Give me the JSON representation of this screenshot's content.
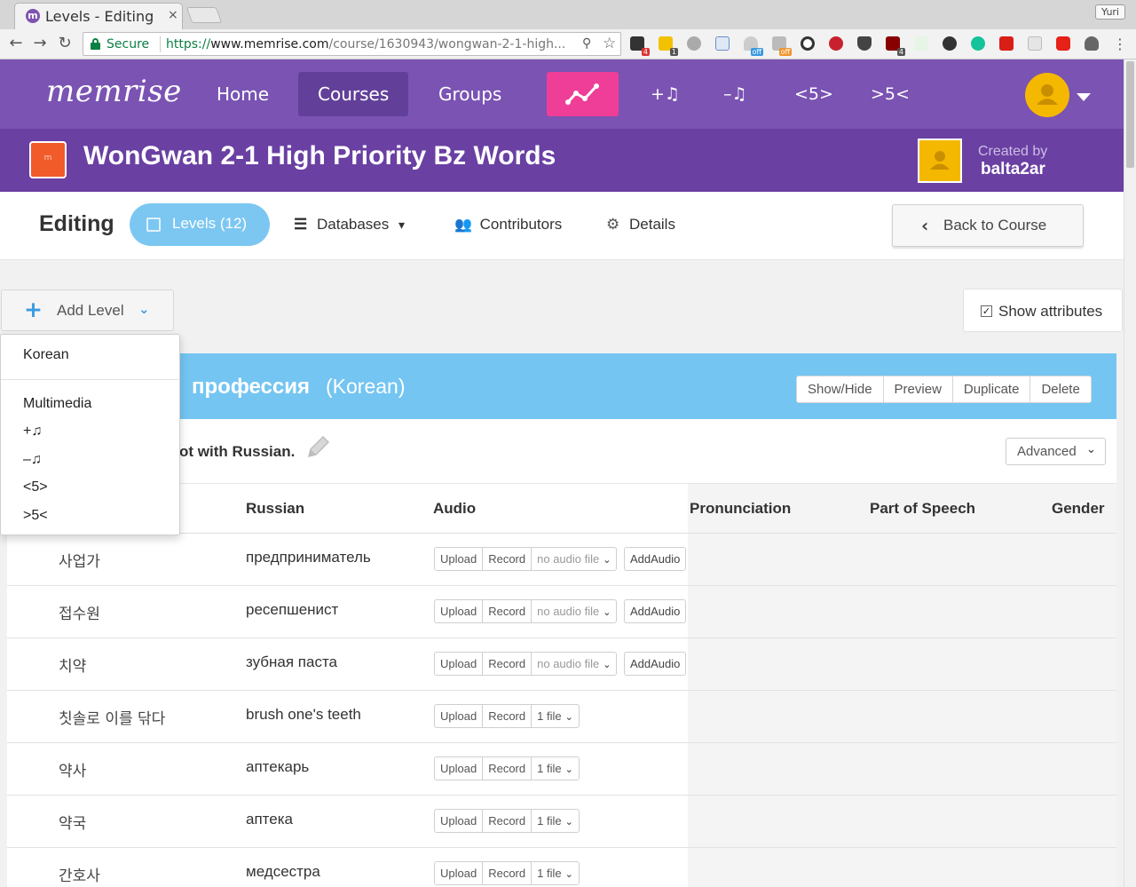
{
  "browser": {
    "tab_title": "Levels - Editing",
    "tab_close": "×",
    "profile_name": "Yuri",
    "secure_label": "Secure",
    "url_scheme": "https://",
    "url_host": "www.memrise.com",
    "url_path": "/course/1630943/wongwan-2-1-high...",
    "extension_badges": [
      "4",
      "1",
      "off",
      "off",
      "4"
    ]
  },
  "topnav": {
    "logo": "memrise",
    "items": [
      {
        "label": "Home",
        "active": false
      },
      {
        "label": "Courses",
        "active": true
      },
      {
        "label": "Groups",
        "active": false
      }
    ],
    "symbols": [
      "+♫",
      "–♫",
      "<5>",
      ">5<"
    ]
  },
  "course": {
    "icon_letter": "m",
    "title": "WonGwan 2-1 High Priority Bz Words",
    "created_by_label": "Created by",
    "creator": "balta2ar"
  },
  "editing": {
    "heading": "Editing",
    "tabs": {
      "levels": "Levels (12)",
      "databases": "Databases",
      "contributors": "Contributors",
      "details": "Details"
    },
    "back_label": "Back to Course"
  },
  "add_level": {
    "label": "Add Level",
    "menu": [
      "Korean",
      "Multimedia",
      "+♫",
      "–♫",
      "<5>",
      ">5<"
    ]
  },
  "show_attributes": {
    "label": "Show attributes",
    "checked": true
  },
  "level": {
    "name_visible": "профессия",
    "language": "(Korean)",
    "actions": [
      "Show/Hide",
      "Preview",
      "Duplicate",
      "Delete"
    ],
    "tester_text": "ot with Russian.",
    "advanced_label": "Advanced",
    "columns": [
      "Russian",
      "Audio",
      "Pronunciation",
      "Part of Speech",
      "Gender"
    ],
    "audio_buttons": {
      "upload": "Upload",
      "record": "Record",
      "add_audio": "AddAudio"
    },
    "rows": [
      {
        "korean": "사업가",
        "russian": "предприниматель",
        "audio": "no audio file",
        "has_audio": false
      },
      {
        "korean": "접수원",
        "russian": "ресепшенист",
        "audio": "no audio file",
        "has_audio": false
      },
      {
        "korean": "치약",
        "russian": "зубная паста",
        "audio": "no audio file",
        "has_audio": false
      },
      {
        "korean": "칫솔로 이를 닦다",
        "russian": "brush one's teeth",
        "audio": "1 file",
        "has_audio": true
      },
      {
        "korean": "약사",
        "russian": "аптекарь",
        "audio": "1 file",
        "has_audio": true
      },
      {
        "korean": "약국",
        "russian": "аптека",
        "audio": "1 file",
        "has_audio": true
      },
      {
        "korean": "간호사",
        "russian": "медсестра",
        "audio": "1 file",
        "has_audio": true
      }
    ]
  },
  "colors": {
    "nav_purple": "#7a53b3",
    "header_purple": "#6a40a3",
    "stats_pink": "#ee3e97",
    "level_blue": "#74c5f1",
    "accent_blue": "#3b9ae1",
    "avatar_yellow": "#f5b800"
  }
}
